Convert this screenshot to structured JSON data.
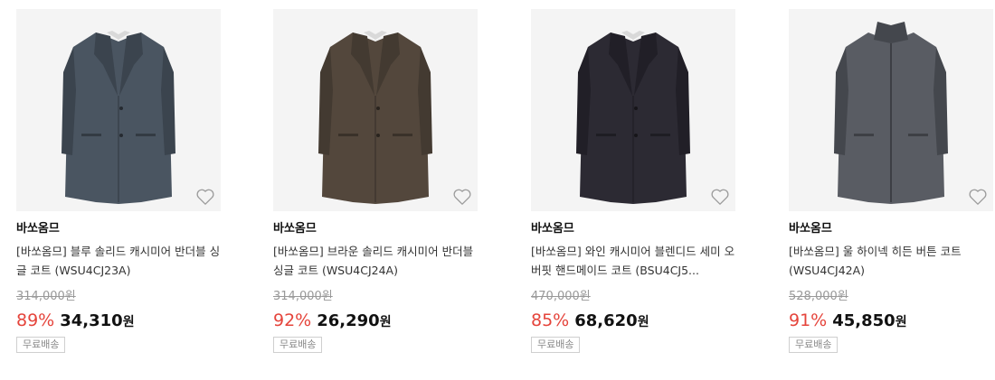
{
  "products": [
    {
      "brand": "바쏘옴므",
      "title": "[바쏘옴므] 블루 솔리드 캐시미어 반더블 싱글 코트 (WSU4CJ23A)",
      "original_price": "314,000",
      "currency_suffix": "원",
      "discount": "89%",
      "price": "34,310",
      "shipping": "무료배송",
      "coat_color": "#4a5561",
      "coat_shade": "#3b444e",
      "collar": "notched"
    },
    {
      "brand": "바쏘옴므",
      "title": "[바쏘옴므] 브라운 솔리드 캐시미어 반더블 싱글 코트 (WSU4CJ24A)",
      "original_price": "314,000",
      "currency_suffix": "원",
      "discount": "92%",
      "price": "26,290",
      "shipping": "무료배송",
      "coat_color": "#53473c",
      "coat_shade": "#433a31",
      "collar": "notched"
    },
    {
      "brand": "바쏘옴므",
      "title": "[바쏘옴므] 와인 캐시미어 블렌디드 세미 오버핏 핸드메이드 코트 (BSU4CJ5...",
      "original_price": "470,000",
      "currency_suffix": "원",
      "discount": "85%",
      "price": "68,620",
      "shipping": "무료배송",
      "coat_color": "#2c2a33",
      "coat_shade": "#211f27",
      "collar": "notched"
    },
    {
      "brand": "바쏘옴므",
      "title": "[바쏘옴므] 울 하이넥 히든 버튼 코트(WSU4CJ42A)",
      "original_price": "528,000",
      "currency_suffix": "원",
      "discount": "91%",
      "price": "45,850",
      "shipping": "무료배송",
      "coat_color": "#595c63",
      "coat_shade": "#44474d",
      "collar": "high-neck"
    }
  ]
}
